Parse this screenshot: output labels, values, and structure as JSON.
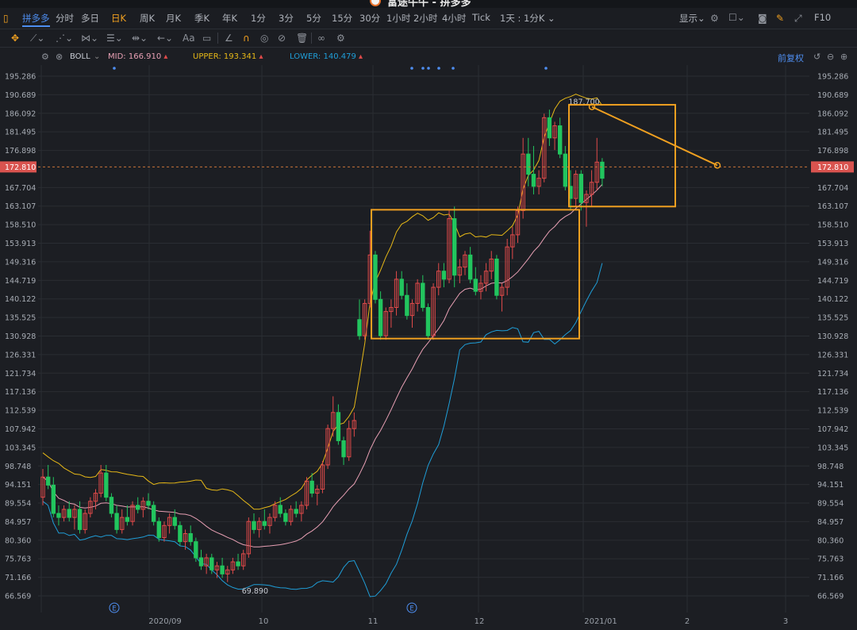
{
  "window": {
    "title": "富途牛牛 - 拼多多"
  },
  "toolbar": {
    "stock_name": "拼多多",
    "periods": [
      "分时",
      "多日",
      "日K",
      "周K",
      "月K",
      "季K",
      "年K",
      "1分",
      "3分",
      "5分",
      "15分",
      "30分",
      "1小时",
      "2小时",
      "4小时",
      "Tick"
    ],
    "active_period": "日K",
    "combo": "1天 : 1分K",
    "display_label": "显示",
    "f10_label": "F10"
  },
  "drawing_tools": [
    "move-icon",
    "line-tool-icon",
    "multi-line-icon",
    "pattern-icon",
    "fibonacci-icon",
    "measure-icon",
    "arrow-icon",
    "text-tool-icon",
    "note-icon",
    "ruler-icon",
    "magnet-icon",
    "eye-icon",
    "hide-icon",
    "delete-icon",
    "link-icon",
    "settings-icon"
  ],
  "indicator": {
    "name": "BOLL",
    "mid_label": "MID:",
    "mid_value": "166.910",
    "upper_label": "UPPER:",
    "upper_value": "193.341",
    "lower_label": "LOWER:",
    "lower_value": "140.479",
    "adjust_label": "前复权"
  },
  "colors": {
    "background": "#1c1e23",
    "up": "#e04a4a",
    "down": "#22c55e",
    "upper_band": "#e6b817",
    "mid_band": "#e8a0b4",
    "lower_band": "#1f9ed8",
    "annotation": "#f0a020",
    "price_tag": "#d9534f"
  },
  "chart_data": {
    "type": "candlestick",
    "y_ticks": [
      "195.286",
      "190.689",
      "186.092",
      "181.495",
      "176.898",
      "172.810",
      "167.704",
      "163.107",
      "158.510",
      "153.913",
      "149.316",
      "144.719",
      "140.122",
      "135.525",
      "130.928",
      "126.331",
      "121.734",
      "117.136",
      "112.539",
      "107.942",
      "103.345",
      "98.748",
      "94.151",
      "89.554",
      "84.957",
      "80.360",
      "75.763",
      "71.166",
      "66.569"
    ],
    "ylim": [
      66.569,
      195.286
    ],
    "x_ticks": [
      "2020/09",
      "10",
      "11",
      "12",
      "2021/01",
      "2",
      "3"
    ],
    "current_price": "172.810",
    "high_label": "187.700",
    "low_label": "69.890",
    "event_markers": [
      "E",
      "E"
    ],
    "candles": [
      [
        91,
        98,
        89,
        96
      ],
      [
        96,
        99,
        93,
        94
      ],
      [
        94,
        96,
        86,
        87
      ],
      [
        87,
        89,
        84,
        86
      ],
      [
        86,
        89,
        85,
        88
      ],
      [
        88,
        90,
        85,
        86
      ],
      [
        86,
        89,
        83,
        88
      ],
      [
        88,
        90,
        82,
        83
      ],
      [
        83,
        88,
        82,
        87
      ],
      [
        87,
        91,
        86,
        90
      ],
      [
        90,
        93,
        88,
        92
      ],
      [
        92,
        99,
        91,
        97
      ],
      [
        97,
        99,
        90,
        91
      ],
      [
        91,
        92,
        86,
        87
      ],
      [
        87,
        89,
        82,
        83
      ],
      [
        83,
        88,
        82,
        86
      ],
      [
        86,
        89,
        84,
        85
      ],
      [
        85,
        90,
        84,
        89
      ],
      [
        89,
        91,
        87,
        88
      ],
      [
        88,
        91,
        86,
        90
      ],
      [
        90,
        92,
        88,
        89
      ],
      [
        89,
        90,
        84,
        85
      ],
      [
        85,
        86,
        80,
        81
      ],
      [
        81,
        85,
        80,
        84
      ],
      [
        84,
        87,
        82,
        86
      ],
      [
        86,
        88,
        83,
        84
      ],
      [
        84,
        85,
        79,
        80
      ],
      [
        80,
        83,
        78,
        82
      ],
      [
        82,
        84,
        79,
        80
      ],
      [
        80,
        81,
        75,
        76
      ],
      [
        76,
        78,
        73,
        74
      ],
      [
        74,
        77,
        72,
        76
      ],
      [
        76,
        77,
        72,
        73
      ],
      [
        73,
        75,
        71,
        74
      ],
      [
        74,
        76,
        71,
        72
      ],
      [
        72,
        74,
        70,
        73
      ],
      [
        73,
        76,
        72,
        75
      ],
      [
        75,
        77,
        73,
        74
      ],
      [
        74,
        78,
        73,
        77
      ],
      [
        77,
        86,
        76,
        85
      ],
      [
        85,
        87,
        82,
        83
      ],
      [
        83,
        86,
        81,
        85
      ],
      [
        85,
        88,
        83,
        84
      ],
      [
        84,
        87,
        82,
        86
      ],
      [
        86,
        90,
        85,
        89
      ],
      [
        89,
        91,
        86,
        87
      ],
      [
        87,
        88,
        84,
        85
      ],
      [
        85,
        89,
        84,
        88
      ],
      [
        88,
        90,
        86,
        87
      ],
      [
        87,
        90,
        85,
        89
      ],
      [
        89,
        96,
        88,
        95
      ],
      [
        95,
        97,
        91,
        92
      ],
      [
        92,
        94,
        89,
        93
      ],
      [
        93,
        100,
        92,
        99
      ],
      [
        99,
        109,
        98,
        108
      ],
      [
        108,
        116,
        106,
        112
      ],
      [
        112,
        114,
        104,
        105
      ],
      [
        105,
        106,
        99,
        101
      ],
      [
        101,
        110,
        100,
        108
      ],
      [
        108,
        112,
        106,
        110
      ],
      [
        135,
        140,
        130,
        131
      ],
      [
        131,
        140,
        130,
        139
      ],
      [
        139,
        157,
        138,
        151
      ],
      [
        151,
        152,
        139,
        140
      ],
      [
        140,
        142,
        130,
        131
      ],
      [
        131,
        138,
        130,
        137
      ],
      [
        137,
        140,
        133,
        138
      ],
      [
        138,
        147,
        136,
        145
      ],
      [
        145,
        147,
        140,
        141
      ],
      [
        141,
        144,
        135,
        136
      ],
      [
        136,
        140,
        133,
        139
      ],
      [
        139,
        145,
        137,
        144
      ],
      [
        144,
        146,
        137,
        138
      ],
      [
        138,
        139,
        130,
        131
      ],
      [
        131,
        144,
        130,
        143
      ],
      [
        143,
        149,
        141,
        147
      ],
      [
        147,
        149,
        143,
        145
      ],
      [
        145,
        162,
        144,
        160
      ],
      [
        160,
        163,
        143,
        146
      ],
      [
        146,
        150,
        144,
        148
      ],
      [
        148,
        152,
        146,
        151
      ],
      [
        151,
        153,
        144,
        145
      ],
      [
        145,
        148,
        141,
        142
      ],
      [
        142,
        146,
        140,
        144
      ],
      [
        144,
        149,
        142,
        147
      ],
      [
        147,
        152,
        145,
        150
      ],
      [
        150,
        151,
        140,
        141
      ],
      [
        141,
        144,
        137,
        143
      ],
      [
        143,
        155,
        141,
        153
      ],
      [
        153,
        158,
        150,
        156
      ],
      [
        156,
        163,
        154,
        162
      ],
      [
        162,
        180,
        160,
        176
      ],
      [
        176,
        180,
        168,
        171
      ],
      [
        171,
        178,
        166,
        168
      ],
      [
        168,
        172,
        166,
        170
      ],
      [
        170,
        186,
        169,
        185
      ],
      [
        185,
        187,
        178,
        180
      ],
      [
        180,
        184,
        177,
        183
      ],
      [
        183,
        185,
        175,
        176
      ],
      [
        176,
        178,
        167,
        168
      ],
      [
        168,
        172,
        162,
        165
      ],
      [
        165,
        172,
        163,
        171
      ],
      [
        171,
        172,
        162,
        164
      ],
      [
        164,
        167,
        158,
        166
      ],
      [
        166,
        172,
        163,
        169
      ],
      [
        169,
        180,
        167,
        174
      ],
      [
        174,
        175,
        168,
        170
      ]
    ]
  }
}
